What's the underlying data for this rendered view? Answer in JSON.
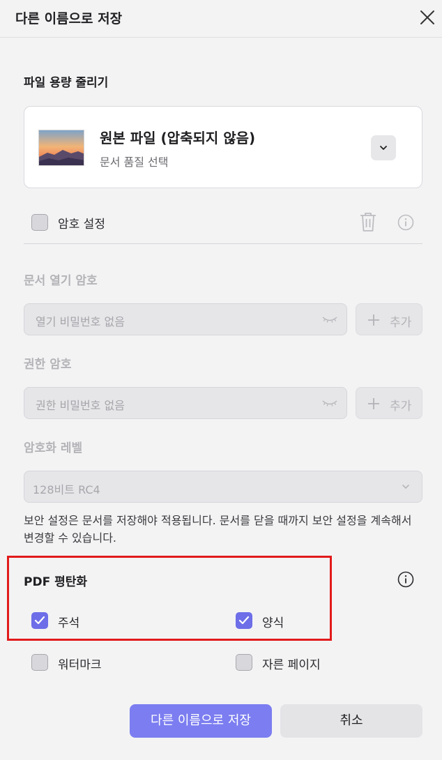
{
  "dialog": {
    "title": "다른 이름으로 저장",
    "close_icon": "close-icon"
  },
  "compress": {
    "section_title": "파일 용량 줄리기",
    "option_title": "원본 파일 (압축되지 않음)",
    "option_subtitle": "문서 품질 선택",
    "thumbnail_icon": "landscape-thumbnail",
    "dropdown_icon": "chevron-down-icon"
  },
  "password": {
    "checkbox_label": "암호 설정",
    "checked": false,
    "delete_icon": "trash-icon",
    "info_icon": "info-icon",
    "open_password": {
      "title": "문서 열기 암호",
      "placeholder": "열기 비밀번호 없음",
      "add_label": "추가"
    },
    "permission_password": {
      "title": "권한 암호",
      "placeholder": "권한 비밀번호 없음",
      "add_label": "추가"
    },
    "encryption": {
      "title": "암호화 레벨",
      "selected": "128비트 RC4"
    },
    "note": "보안 설정은 문서를 저장해야 적용됩니다. 문서를 닫을 때까지 보안 설정을 계속해서 변경할 수 있습니다."
  },
  "flatten": {
    "title": "PDF 평탄화",
    "info_icon": "info-icon",
    "options": [
      {
        "label": "주석",
        "checked": true
      },
      {
        "label": "양식",
        "checked": true
      },
      {
        "label": "워터마크",
        "checked": false
      },
      {
        "label": "자른 페이지",
        "checked": false
      }
    ]
  },
  "buttons": {
    "save_as": "다른 이름으로 저장",
    "cancel": "취소"
  },
  "colors": {
    "accent": "#7b7df0",
    "highlight": "#e21a1a",
    "background": "#f3f3f4"
  }
}
